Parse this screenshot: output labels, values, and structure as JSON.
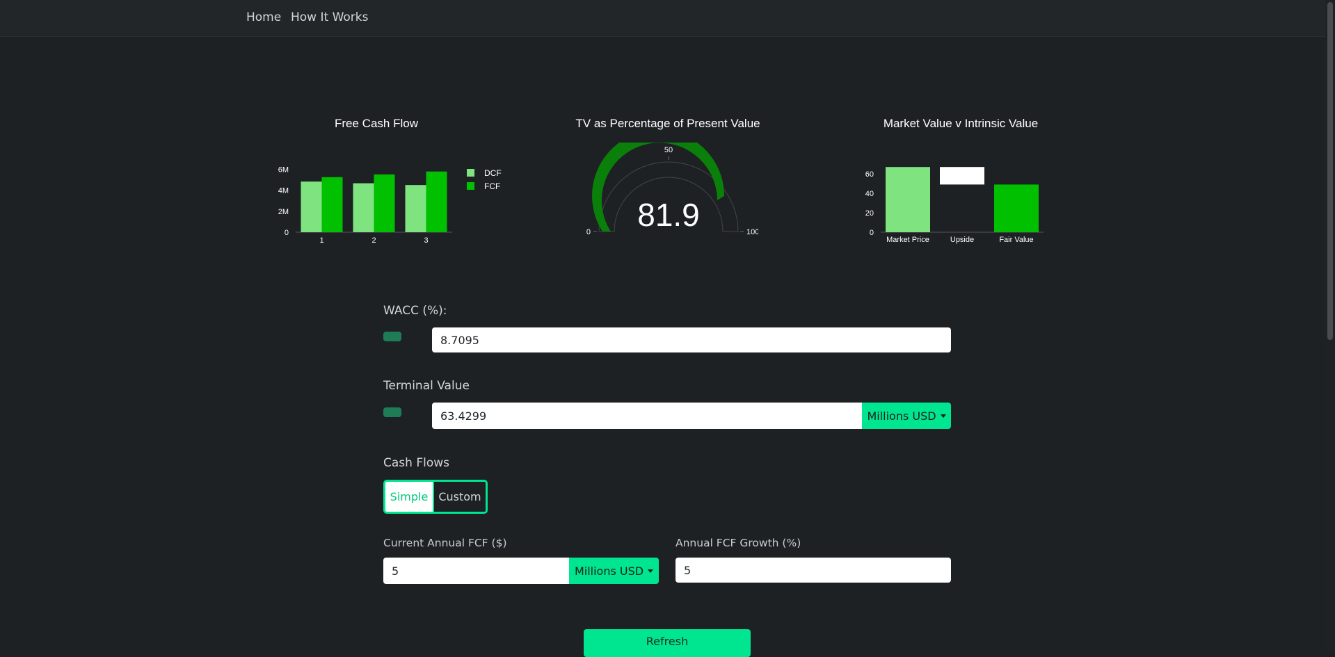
{
  "nav": {
    "home": "Home",
    "how_it_works": "How It Works"
  },
  "charts": {
    "fcf_title": "Free Cash Flow",
    "tv_title": "TV as Percentage of Present Value",
    "mv_title": "Market Value v Intrinsic Value"
  },
  "chart_data": [
    {
      "type": "bar",
      "title": "Free Cash Flow",
      "categories": [
        "1",
        "2",
        "3"
      ],
      "series": [
        {
          "name": "DCF",
          "values": [
            4.83,
            4.67,
            4.5
          ],
          "color": "#7fe37f"
        },
        {
          "name": "FCF",
          "values": [
            5.25,
            5.51,
            5.79
          ],
          "color": "#00c000"
        }
      ],
      "yticks": [
        "0",
        "2M",
        "4M",
        "6M"
      ],
      "ylim": [
        0,
        6.5
      ],
      "legend": "right"
    },
    {
      "type": "gauge",
      "title": "TV as Percentage of Present Value",
      "value": 81.9,
      "value_label": "81.9",
      "range": [
        0,
        100
      ],
      "tick_labels": [
        "0",
        "50",
        "100"
      ],
      "bar_color": "#0a7f0a"
    },
    {
      "type": "bar",
      "title": "Market Value v Intrinsic Value",
      "categories": [
        "Market Price",
        "Upside",
        "Fair Value"
      ],
      "values": [
        67,
        -18,
        49
      ],
      "upside_range": [
        49,
        67
      ],
      "colors": [
        "#7fe37f",
        "#ffffff",
        "#00c000"
      ],
      "yticks": [
        "0",
        "20",
        "40",
        "60"
      ],
      "ylim": [
        0,
        70
      ]
    }
  ],
  "form": {
    "wacc_label": "WACC (%):",
    "wacc_value": "8.7095",
    "tv_label": "Terminal Value",
    "tv_value": "63.4299",
    "tv_unit": "Millions USD",
    "cash_flows_label": "Cash Flows",
    "mode_simple": "Simple",
    "mode_custom": "Custom",
    "current_fcf_label": "Current Annual FCF ($)",
    "current_fcf_value": "5",
    "current_fcf_unit": "Millions USD",
    "growth_label": "Annual FCF Growth (%)",
    "growth_value": "5",
    "refresh": "Refresh"
  },
  "colors": {
    "accent": "#00e58f",
    "background": "#1e2124",
    "navbar": "#232629"
  }
}
